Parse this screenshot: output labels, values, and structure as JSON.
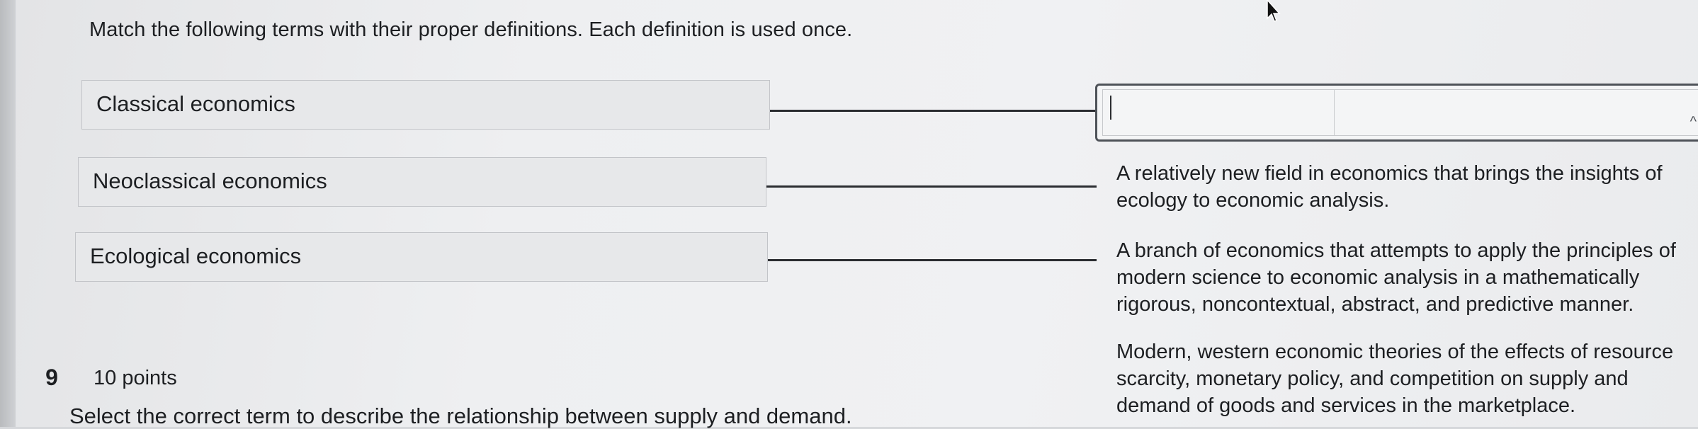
{
  "instructions": "Match the following terms with their proper definitions. Each definition is used once.",
  "terms": [
    {
      "label": "Classical economics"
    },
    {
      "label": "Neoclassical economics"
    },
    {
      "label": "Ecological economics"
    }
  ],
  "answer_slot": {
    "value": ""
  },
  "definitions": [
    {
      "text": "A relatively new field in economics that brings the insights of\necology to economic analysis."
    },
    {
      "text": "A branch of economics that attempts to apply the principles of\nmodern science to economic analysis in a mathematically\nrigorous, noncontextual, abstract, and predictive manner."
    },
    {
      "text": "Modern, western economic theories of the effects of resource\nscarcity, monetary policy, and competition on supply and\ndemand of goods and services in the marketplace."
    }
  ],
  "next_question": {
    "number": "9",
    "points": "10 points",
    "prompt": "Select the correct term to describe the relationship between supply and demand."
  }
}
